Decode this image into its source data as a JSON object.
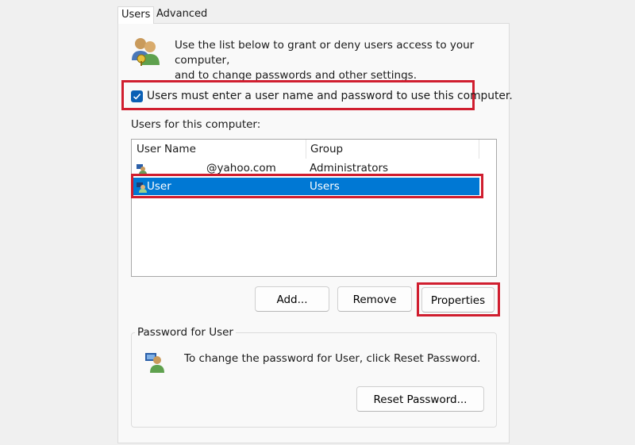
{
  "tabs": [
    {
      "label": "Users",
      "active": true
    },
    {
      "label": "Advanced",
      "active": false
    }
  ],
  "intro": {
    "icon": "users-icon",
    "line1": "Use the list below to grant or deny users access to your computer,",
    "line2": "and to change passwords and other settings."
  },
  "require_login": {
    "checked": true,
    "label": "Users must enter a user name and password to use this computer."
  },
  "users_list": {
    "label": "Users for this computer:",
    "columns": [
      "User Name",
      "Group"
    ],
    "rows": [
      {
        "user_name": "@yahoo.com",
        "group": "Administrators",
        "selected": false,
        "icon": "user-icon"
      },
      {
        "user_name": "User",
        "group": "Users",
        "selected": true,
        "icon": "user-icon"
      }
    ]
  },
  "buttons": {
    "add": "Add...",
    "remove": "Remove",
    "properties": "Properties"
  },
  "password_group": {
    "title": "Password for User",
    "icon": "user-key-icon",
    "text": "To change the password for User, click Reset Password.",
    "reset_button": "Reset Password..."
  },
  "colors": {
    "selection": "#0078d4",
    "highlight_box": "#d01e2f",
    "checkbox": "#0a5fb4"
  }
}
